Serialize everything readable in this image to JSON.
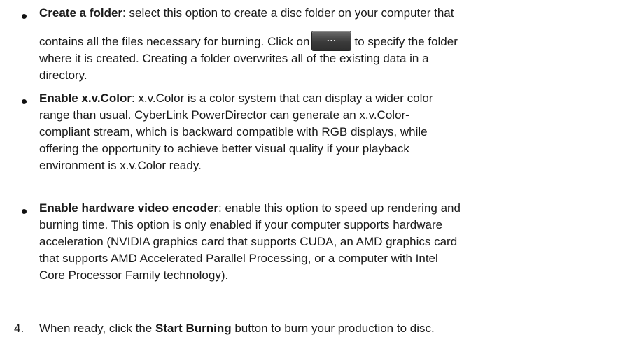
{
  "items": [
    {
      "term": "Create a folder",
      "lines": [
        ": select this option to create a disc folder on your computer that",
        "contains all the files necessary for burning. Click on",
        "to specify the folder",
        "where it is created. Creating a folder overwrites all of the existing data in a",
        "directory."
      ],
      "button_label": "..."
    },
    {
      "term": "Enable x.v.Color",
      "lines": [
        ": x.v.Color is a color system that can display a wider color",
        "range than usual. CyberLink PowerDirector can generate an x.v.Color-",
        "compliant stream, which is backward compatible with RGB displays, while",
        "offering the opportunity to achieve better visual quality if your playback",
        "environment is x.v.Color ready."
      ]
    },
    {
      "term": "Enable hardware video encoder",
      "lines": [
        ": enable this option to speed up rendering and",
        "burning time. This option is only enabled if your computer supports hardware",
        "acceleration (NVIDIA graphics card that supports CUDA, an AMD graphics card",
        "that supports AMD Accelerated Parallel Processing, or a computer with Intel",
        "Core Processor Family technology)."
      ]
    }
  ],
  "step": {
    "number": "4.",
    "before": "When ready, click the ",
    "button_name": "Start Burning",
    "after": " button to burn your production to disc."
  }
}
